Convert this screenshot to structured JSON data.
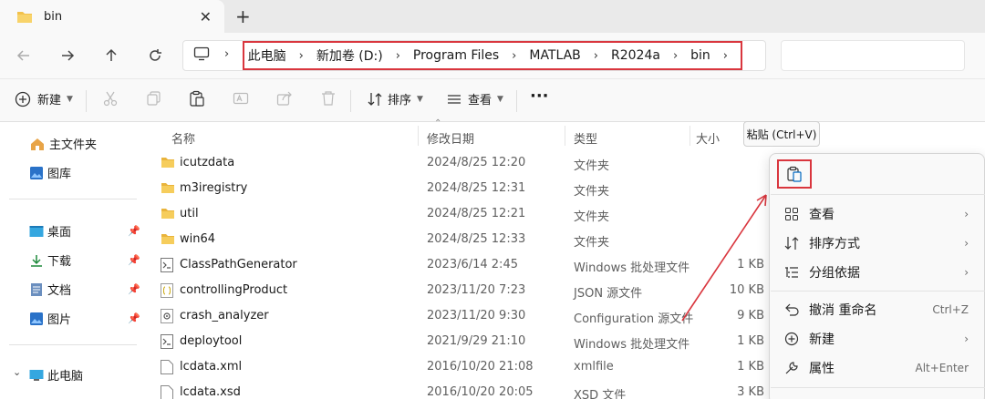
{
  "window": {
    "tab_title": "bin",
    "close_glyph": "✕",
    "new_tab_glyph": "+"
  },
  "nav": {
    "chevron": "›",
    "breadcrumb": [
      "此电脑",
      "新加卷 (D:)",
      "Program Files",
      "MATLAB",
      "R2024a",
      "bin"
    ]
  },
  "toolbar": {
    "new_label": "新建",
    "sort_label": "排序",
    "view_label": "查看",
    "more_glyph": "···"
  },
  "sidebar": {
    "items": [
      {
        "label": "主文件夹",
        "icon": "home-icon"
      },
      {
        "label": "图库",
        "icon": "gallery-icon"
      },
      {
        "label": "桌面",
        "icon": "desktop-icon"
      },
      {
        "label": "下载",
        "icon": "download-icon"
      },
      {
        "label": "文档",
        "icon": "document-icon"
      },
      {
        "label": "图片",
        "icon": "pictures-icon"
      },
      {
        "label": "此电脑",
        "icon": "computer-icon"
      }
    ]
  },
  "list": {
    "headers": {
      "name": "名称",
      "date": "修改日期",
      "type": "类型",
      "size": "大小"
    },
    "rows": [
      {
        "name": "icutzdata",
        "date": "2024/8/25 12:20",
        "type": "文件夹",
        "size": "",
        "icon": "folder-icon"
      },
      {
        "name": "m3iregistry",
        "date": "2024/8/25 12:31",
        "type": "文件夹",
        "size": "",
        "icon": "folder-icon"
      },
      {
        "name": "util",
        "date": "2024/8/25 12:21",
        "type": "文件夹",
        "size": "",
        "icon": "folder-icon"
      },
      {
        "name": "win64",
        "date": "2024/8/25 12:33",
        "type": "文件夹",
        "size": "",
        "icon": "folder-icon"
      },
      {
        "name": "ClassPathGenerator",
        "date": "2023/6/14 2:45",
        "type": "Windows 批处理文件",
        "size": "1 KB",
        "icon": "batch-file-icon"
      },
      {
        "name": "controllingProduct",
        "date": "2023/11/20 7:23",
        "type": "JSON 源文件",
        "size": "10 KB",
        "icon": "json-file-icon"
      },
      {
        "name": "crash_analyzer",
        "date": "2023/11/20 9:30",
        "type": "Configuration 源文件",
        "size": "9 KB",
        "icon": "config-file-icon"
      },
      {
        "name": "deploytool",
        "date": "2021/9/29 21:10",
        "type": "Windows 批处理文件",
        "size": "1 KB",
        "icon": "batch-file-icon"
      },
      {
        "name": "lcdata.xml",
        "date": "2016/10/20 21:08",
        "type": "xmlfile",
        "size": "1 KB",
        "icon": "file-icon"
      },
      {
        "name": "lcdata.xsd",
        "date": "2016/10/20 20:05",
        "type": "XSD 文件",
        "size": "3 KB",
        "icon": "file-icon"
      }
    ]
  },
  "tooltip": {
    "text": "粘贴 (Ctrl+V)"
  },
  "context_menu": {
    "items": [
      {
        "label": "查看",
        "shortcut": "",
        "submenu": true,
        "icon": "view-icon"
      },
      {
        "label": "排序方式",
        "shortcut": "",
        "submenu": true,
        "icon": "sort-icon"
      },
      {
        "label": "分组依据",
        "shortcut": "",
        "submenu": true,
        "icon": "group-icon"
      },
      {
        "label": "撤消 重命名",
        "shortcut": "Ctrl+Z",
        "submenu": false,
        "icon": "undo-icon"
      },
      {
        "label": "新建",
        "shortcut": "",
        "submenu": true,
        "icon": "new-icon"
      },
      {
        "label": "属性",
        "shortcut": "Alt+Enter",
        "submenu": false,
        "icon": "properties-icon"
      }
    ],
    "submenu_glyph": "›"
  },
  "colors": {
    "highlight": "#d9363e",
    "folder": "#f2c14b",
    "accent": "#0067c0"
  }
}
